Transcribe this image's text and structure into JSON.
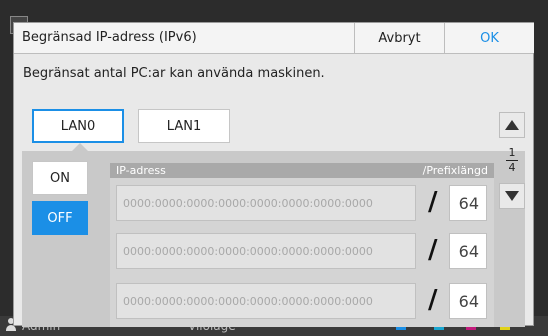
{
  "background": {
    "user": "Admin",
    "mode": "Viloläge"
  },
  "dialog": {
    "title": "Begränsad IP-adress (IPv6)",
    "cancel_label": "Avbryt",
    "ok_label": "OK",
    "description": "Begränsat antal PC:ar kan använda maskinen."
  },
  "tabs": [
    {
      "label": "LAN0",
      "active": true
    },
    {
      "label": "LAN1",
      "active": false
    }
  ],
  "toggle": {
    "on_label": "ON",
    "off_label": "OFF",
    "selected": "OFF"
  },
  "list": {
    "header_address": "IP-adress",
    "header_prefix": "/Prefixlängd",
    "separator": "/",
    "rows": [
      {
        "address": "0000:0000:0000:0000:0000:0000:0000:0000",
        "prefix": "64"
      },
      {
        "address": "0000:0000:0000:0000:0000:0000:0000:0000",
        "prefix": "64"
      },
      {
        "address": "0000:0000:0000:0000:0000:0000:0000:0000",
        "prefix": "64"
      }
    ]
  },
  "pagination": {
    "current": "1",
    "total": "4"
  },
  "colors": {
    "accent": "#1b8fe6",
    "panel": "#c9c9c9",
    "dialog_bg": "#e9e9e9"
  }
}
